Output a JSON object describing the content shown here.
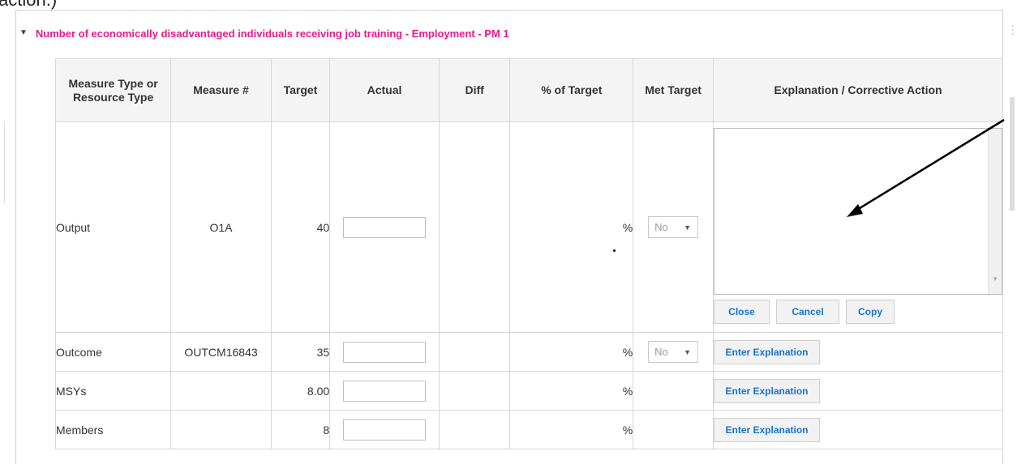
{
  "fragment": "action.)",
  "section": {
    "title": "Number of economically disadvantaged individuals receiving job training - Employment - PM 1"
  },
  "table": {
    "headers": [
      "Measure Type or Resource Type",
      "Measure #",
      "Target",
      "Actual",
      "Diff",
      "% of Target",
      "Met Target",
      "Explanation / Corrective Action"
    ],
    "rows": [
      {
        "type": "Output",
        "measure": "O1A",
        "target": "40",
        "actual": "",
        "diff": "",
        "pct": "%",
        "met": "No"
      },
      {
        "type": "Outcome",
        "measure": "OUTCM16843",
        "target": "35",
        "actual": "",
        "diff": "",
        "pct": "%",
        "met": "No"
      },
      {
        "type": "MSYs",
        "measure": "",
        "target": "8.00",
        "actual": "",
        "diff": "",
        "pct": "%",
        "met": ""
      },
      {
        "type": "Members",
        "measure": "",
        "target": "8",
        "actual": "",
        "diff": "",
        "pct": "%",
        "met": ""
      }
    ]
  },
  "buttons": {
    "close": "Close",
    "cancel": "Cancel",
    "copy": "Copy",
    "enter_explanation": "Enter Explanation"
  },
  "colors": {
    "section_title": "#e61a8d",
    "button_text": "#1a73c9",
    "header_bg": "#f4f4f4"
  },
  "icons": {
    "caret": "triangle-down",
    "select_arrow": "triangle-down"
  }
}
